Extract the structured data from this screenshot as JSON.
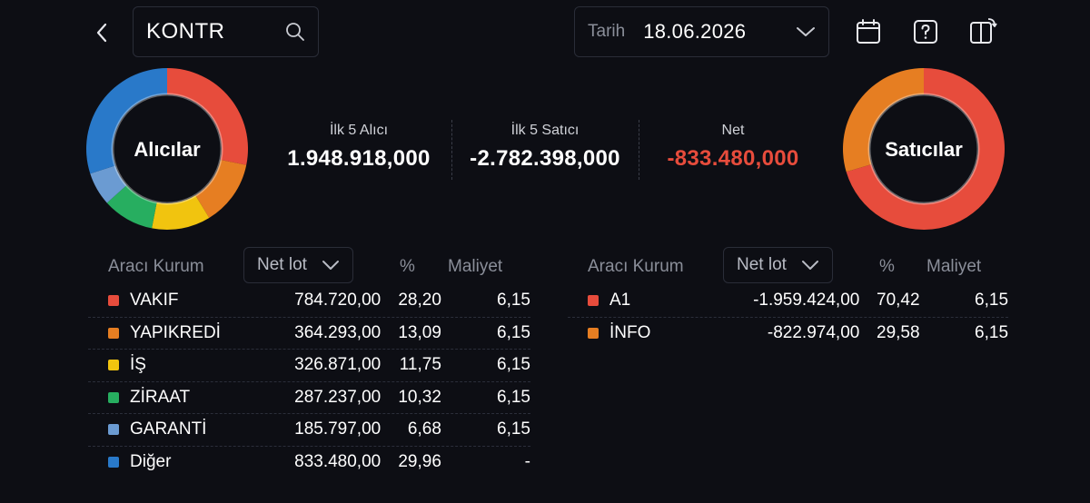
{
  "header": {
    "search_value": "KONTR",
    "date_label": "Tarih",
    "date_value": "18.06.2026",
    "icons": [
      "chevron-left-icon",
      "search-icon",
      "chevron-down-icon",
      "calendar-icon",
      "help-icon",
      "layout-switch-icon"
    ]
  },
  "buyers_donut": {
    "label": "Alıcılar",
    "segments": [
      {
        "name": "VAKIF",
        "pct": 28.2,
        "color": "#e74c3c"
      },
      {
        "name": "YAPIKREDİ",
        "pct": 13.09,
        "color": "#e67e22"
      },
      {
        "name": "İŞ",
        "pct": 11.75,
        "color": "#f1c40f"
      },
      {
        "name": "ZİRAAT",
        "pct": 10.32,
        "color": "#27ae60"
      },
      {
        "name": "GARANTİ",
        "pct": 6.68,
        "color": "#6b9bd2"
      },
      {
        "name": "Diğer",
        "pct": 29.96,
        "color": "#2979c9"
      }
    ]
  },
  "sellers_donut": {
    "label": "Satıcılar",
    "segments": [
      {
        "name": "A1",
        "pct": 70.42,
        "color": "#e74c3c"
      },
      {
        "name": "İNFO",
        "pct": 29.58,
        "color": "#e67e22"
      }
    ]
  },
  "stats": {
    "top5_buyers_label": "İlk 5 Alıcı",
    "top5_buyers_value": "1.948.918,000",
    "top5_sellers_label": "İlk 5 Satıcı",
    "top5_sellers_value": "-2.782.398,000",
    "net_label": "Net",
    "net_value": "-833.480,000",
    "net_color": "#e74c3c"
  },
  "columns": {
    "broker": "Aracı Kurum",
    "net_lot": "Net lot",
    "pct": "%",
    "cost": "Maliyet"
  },
  "buyers": [
    {
      "name": "VAKIF",
      "lot": "784.720,00",
      "pct": "28,20",
      "cost": "6,15",
      "color": "#e74c3c"
    },
    {
      "name": "YAPIKREDİ",
      "lot": "364.293,00",
      "pct": "13,09",
      "cost": "6,15",
      "color": "#e67e22"
    },
    {
      "name": "İŞ",
      "lot": "326.871,00",
      "pct": "11,75",
      "cost": "6,15",
      "color": "#f1c40f"
    },
    {
      "name": "ZİRAAT",
      "lot": "287.237,00",
      "pct": "10,32",
      "cost": "6,15",
      "color": "#27ae60"
    },
    {
      "name": "GARANTİ",
      "lot": "185.797,00",
      "pct": "6,68",
      "cost": "6,15",
      "color": "#6b9bd2"
    },
    {
      "name": "Diğer",
      "lot": "833.480,00",
      "pct": "29,96",
      "cost": "-",
      "color": "#2979c9"
    }
  ],
  "sellers": [
    {
      "name": "A1",
      "lot": "-1.959.424,00",
      "pct": "70,42",
      "cost": "6,15",
      "color": "#e74c3c"
    },
    {
      "name": "İNFO",
      "lot": "-822.974,00",
      "pct": "29,58",
      "cost": "6,15",
      "color": "#e67e22"
    }
  ]
}
